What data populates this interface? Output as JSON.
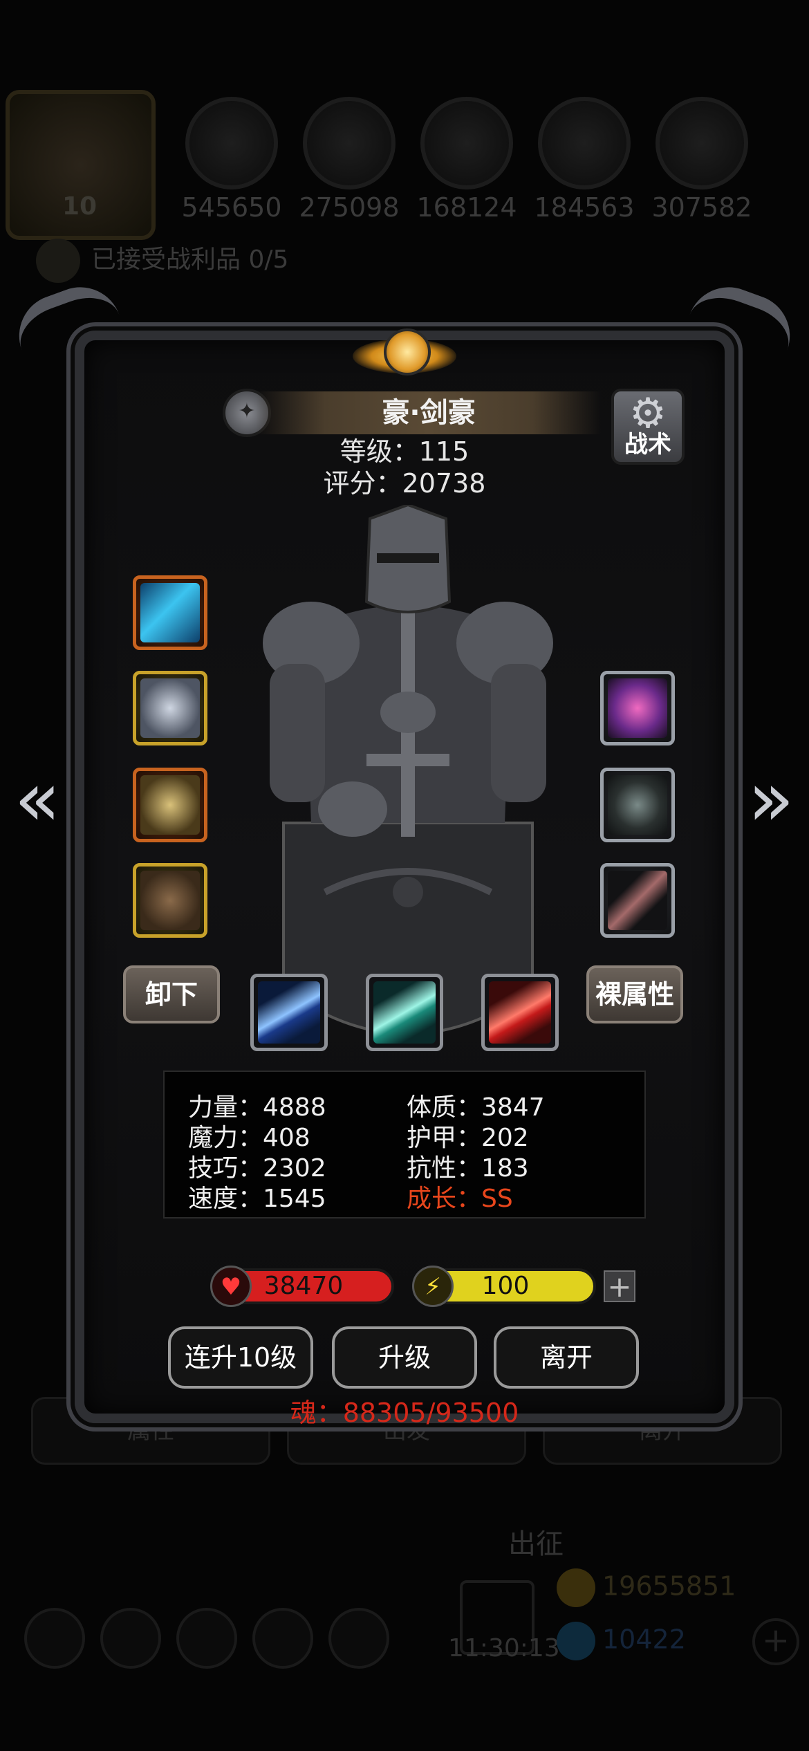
{
  "background": {
    "avatar_level": "10",
    "resources": [
      "545650",
      "275098",
      "168124",
      "184563",
      "307582"
    ],
    "quest_text": "已接受战利品 0/5",
    "tabs": [
      "属性",
      "出发",
      "离开"
    ],
    "deploy_label": "出征",
    "clock": "11:30:13",
    "gold": "19655851",
    "gems": "10422"
  },
  "hero": {
    "name": "豪·剑豪",
    "level_label": "等级：115",
    "score_label": "评分：20738",
    "tactics_label": "战术",
    "portrait_icon": "armored-knight-with-shield"
  },
  "equipment": {
    "left": [
      {
        "name": "weapon-slot",
        "icon": "blue-crystal-sword-icon",
        "rarity": "orange"
      },
      {
        "name": "armor-slot",
        "icon": "steel-chestplate-icon",
        "rarity": "gold"
      },
      {
        "name": "helmet-slot",
        "icon": "golden-helmet-icon",
        "rarity": "orange"
      },
      {
        "name": "ring-slot",
        "icon": "ornate-ring-icon",
        "rarity": "gold"
      }
    ],
    "right": [
      {
        "name": "gem-slot-1",
        "icon": "purple-gem-icon",
        "rarity": "grey"
      },
      {
        "name": "gem-slot-2",
        "icon": "grey-stone-icon",
        "rarity": "grey"
      },
      {
        "name": "gem-slot-3",
        "icon": "feather-shard-icon",
        "rarity": "grey"
      }
    ]
  },
  "buttons": {
    "unequip": "卸下",
    "base_stats": "裸属性",
    "level_up_10": "连升10级",
    "level_up": "升级",
    "leave": "离开"
  },
  "skills": [
    {
      "name": "skill-blue-slash",
      "icon": "blue-slash-icon",
      "color": "#3a7bd5"
    },
    {
      "name": "skill-teal-slash",
      "icon": "teal-slash-icon",
      "color": "#2fc2b0"
    },
    {
      "name": "skill-red-slash",
      "icon": "red-slash-icon",
      "color": "#d42a2a"
    }
  ],
  "stats": {
    "strength": "力量：4888",
    "magic": "魔力：408",
    "skill": "技巧：2302",
    "speed": "速度：1545",
    "constitution": "体质：3847",
    "armor": "护甲：202",
    "resistance": "抗性：183",
    "growth": "成长：SS"
  },
  "bars": {
    "hp": "38470",
    "energy": "100",
    "hp_color": "#d61f1f",
    "energy_color": "#e0d21e"
  },
  "soul": "魂：88305/93500"
}
